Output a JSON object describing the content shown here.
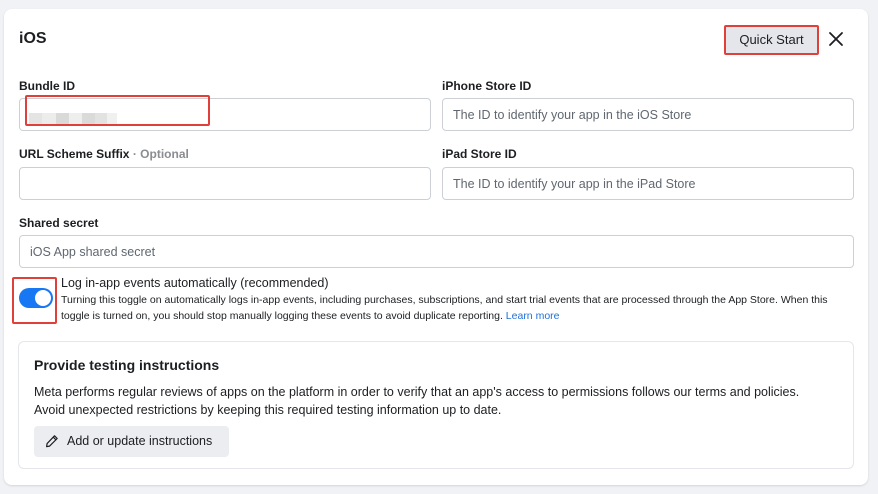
{
  "header": {
    "title": "iOS",
    "quick_start_label": "Quick Start"
  },
  "fields": {
    "bundle_id": {
      "label": "Bundle ID",
      "value": ""
    },
    "iphone_store_id": {
      "label": "iPhone Store ID",
      "placeholder": "The ID to identify your app in the iOS Store"
    },
    "url_scheme_suffix": {
      "label": "URL Scheme Suffix",
      "optional_tag": "· Optional",
      "value": ""
    },
    "ipad_store_id": {
      "label": "iPad Store ID",
      "placeholder": "The ID to identify your app in the iPad Store"
    },
    "shared_secret": {
      "label": "Shared secret",
      "placeholder": "iOS App shared secret"
    }
  },
  "auto_log": {
    "enabled": true,
    "title": "Log in-app events automatically (recommended)",
    "description": "Turning this toggle on automatically logs in-app events, including purchases, subscriptions, and start trial events that are processed through the App Store. When this toggle is turned on, you should stop manually logging these events to avoid duplicate reporting.",
    "learn_more": "Learn more"
  },
  "testing": {
    "title": "Provide testing instructions",
    "line1": "Meta performs regular reviews of apps on the platform in order to verify that an app's access to permissions follows our terms and policies.",
    "line2": "Avoid unexpected restrictions by keeping this required testing information up to date.",
    "button_label": "Add or update instructions"
  },
  "icons": {
    "close": "close-icon",
    "pencil": "pencil-icon"
  },
  "colors": {
    "accent": "#1877f2",
    "highlight": "#e0403a",
    "link": "#216fdb"
  }
}
